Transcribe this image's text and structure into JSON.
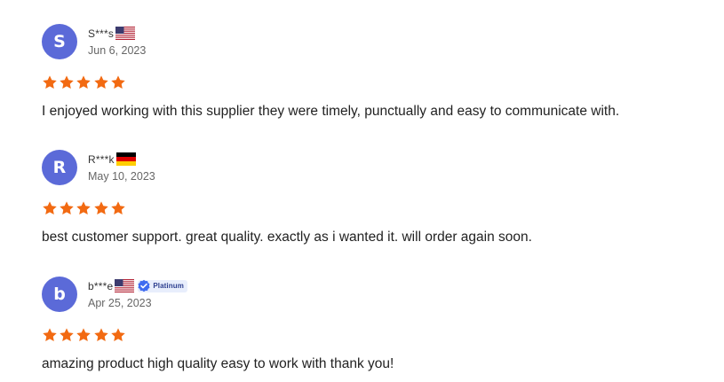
{
  "reviews": [
    {
      "avatar_letter": "S",
      "name": "S***s",
      "flag": "us-flag-icon",
      "badge": null,
      "date": "Jun 6, 2023",
      "rating": 5,
      "text": "I enjoyed working with this supplier they were timely, punctually and easy to communicate with."
    },
    {
      "avatar_letter": "R",
      "name": "R***k",
      "flag": "de-flag-icon",
      "badge": null,
      "date": "May 10, 2023",
      "rating": 5,
      "text": "best customer support. great quality. exactly as i wanted it. will order again soon."
    },
    {
      "avatar_letter": "b",
      "name": "b***e",
      "flag": "us-flag-icon",
      "badge": "Platinum",
      "date": "Apr 25, 2023",
      "rating": 5,
      "text": "amazing product high quality easy to work with thank you!"
    }
  ],
  "colors": {
    "avatar": "#5b6ad8",
    "star": "#f26a12",
    "badge_bg": "#e8eefc",
    "badge_icon": "#3f6bf0"
  }
}
